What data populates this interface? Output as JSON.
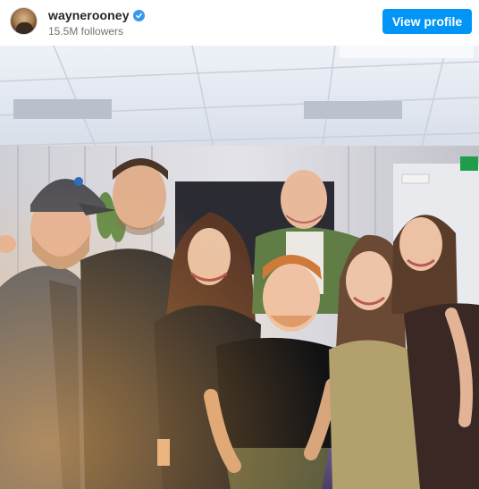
{
  "profile": {
    "username": "waynerooney",
    "verified": true,
    "followers": "15.5M followers",
    "avatar_icon": "profile-avatar"
  },
  "actions": {
    "view_profile_label": "View profile"
  },
  "sign": {
    "exit_icon": "exit-sign-icon"
  },
  "colors": {
    "accent": "#0095f6",
    "verified": "#3897f0",
    "muted_text": "#737373"
  }
}
